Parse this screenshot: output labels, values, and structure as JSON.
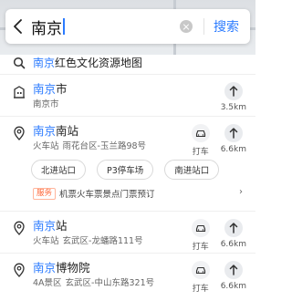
{
  "search": {
    "query": "南京",
    "search_label": "搜索"
  },
  "suggestions": {
    "top_row": {
      "highlight": "南京",
      "rest": "红色文化资源地图"
    },
    "city": {
      "title_hl": "南京",
      "title_rest": "市",
      "sub": "南京市",
      "distance": "3.5km"
    },
    "south_station": {
      "title_hl": "南京",
      "title_rest": "南站",
      "category": "火车站",
      "address": "雨花台区-玉兰路98号",
      "taxi_label": "打车",
      "distance": "6.6km",
      "entrances": [
        "北进站口",
        "P3停车场",
        "南进站口"
      ],
      "service_tag": "服务",
      "service_text": "机票火车票景点门票预订"
    },
    "station": {
      "title_hl": "南京",
      "title_rest": "站",
      "category": "火车站",
      "address": "玄武区-龙蟠路111号",
      "taxi_label": "打车",
      "distance": "6.6km"
    },
    "museum": {
      "title_hl": "南京",
      "title_rest": "博物院",
      "category": "4A景区",
      "address": "玄武区-中山东路321号",
      "taxi_label": "打车",
      "distance": "6.6km"
    }
  },
  "colors": {
    "accent": "#2b7bff",
    "service": "#ff6a3c"
  }
}
